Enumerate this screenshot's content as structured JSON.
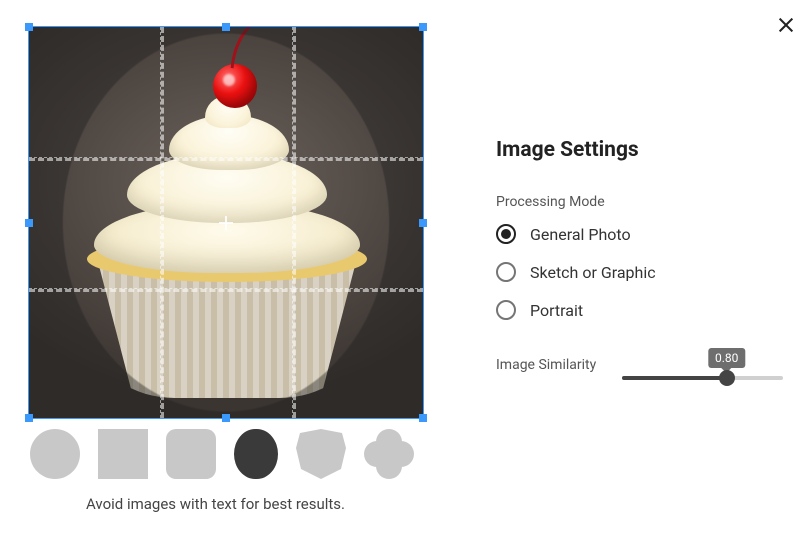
{
  "close_label": "Close",
  "settings": {
    "title": "Image Settings",
    "processing_mode": {
      "label": "Processing Mode",
      "options": [
        "General Photo",
        "Sketch or Graphic",
        "Portrait"
      ],
      "selected_index": 0
    },
    "similarity": {
      "label": "Image Similarity",
      "value_text": "0.80",
      "percent": 65
    }
  },
  "shapes": {
    "options": [
      "circle",
      "square",
      "rounded-square",
      "capsule",
      "shield",
      "clover"
    ],
    "selected_index": 3
  },
  "hint": "Avoid images with text for best results."
}
